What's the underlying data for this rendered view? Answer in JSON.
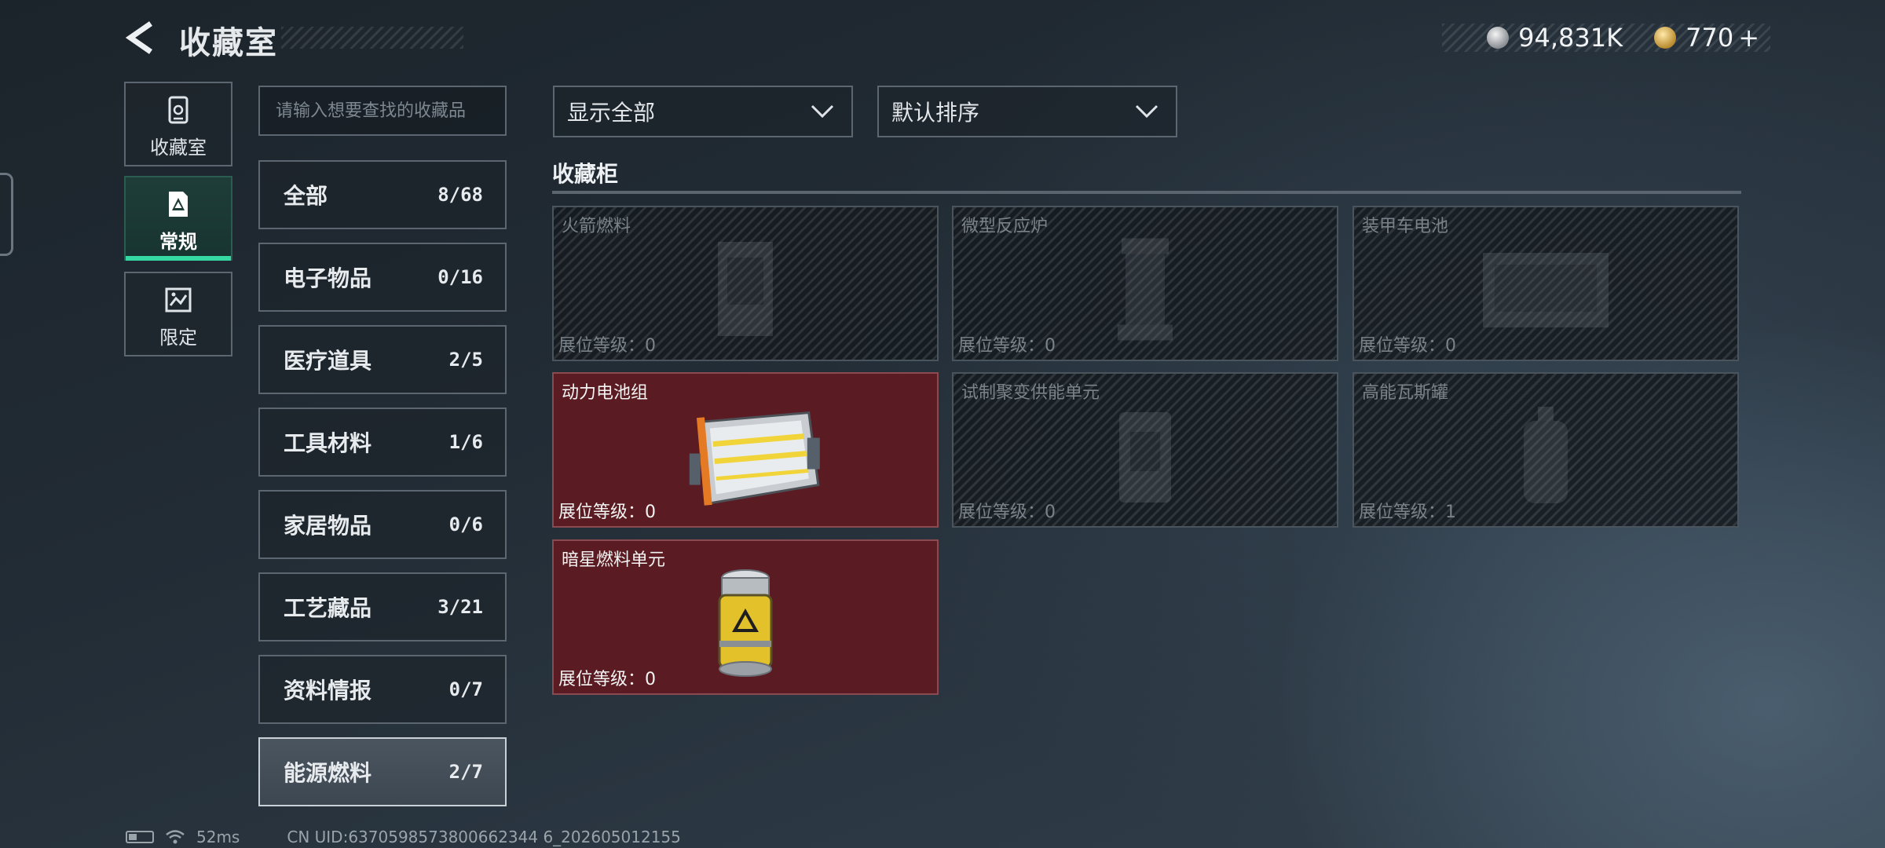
{
  "header": {
    "title": "收藏室",
    "currency_silver": "94,831K",
    "currency_gold": "770",
    "add_symbol": "+"
  },
  "side_tabs": [
    {
      "label": "收藏室",
      "icon": "collection-room-icon"
    },
    {
      "label": "常规",
      "icon": "regular-icon",
      "active": true
    },
    {
      "label": "限定",
      "icon": "limited-icon"
    }
  ],
  "search": {
    "placeholder": "请输入想要查找的收藏品"
  },
  "categories": [
    {
      "name": "全部",
      "count": "8/68"
    },
    {
      "name": "电子物品",
      "count": "0/16"
    },
    {
      "name": "医疗道具",
      "count": "2/5"
    },
    {
      "name": "工具材料",
      "count": "1/6"
    },
    {
      "name": "家居物品",
      "count": "0/6"
    },
    {
      "name": "工艺藏品",
      "count": "3/21"
    },
    {
      "name": "资料情报",
      "count": "0/7"
    },
    {
      "name": "能源燃料",
      "count": "2/7",
      "active": true
    }
  ],
  "filters": {
    "display": "显示全部",
    "sort": "默认排序"
  },
  "section": {
    "title": "收藏柜"
  },
  "items": [
    {
      "name": "火箭燃料",
      "level": "展位等级：0",
      "owned": false
    },
    {
      "name": "微型反应炉",
      "level": "展位等级：0",
      "owned": false
    },
    {
      "name": "装甲车电池",
      "level": "展位等级：0",
      "owned": false
    },
    {
      "name": "动力电池组",
      "level": "展位等级：0",
      "owned": true
    },
    {
      "name": "试制聚变供能单元",
      "level": "展位等级：0",
      "owned": false
    },
    {
      "name": "高能瓦斯罐",
      "level": "展位等级：1",
      "owned": false
    },
    {
      "name": "暗星燃料单元",
      "level": "展位等级：0",
      "owned": true
    }
  ],
  "status": {
    "ping": "52ms",
    "uid": "CN UID:6370598573800662344 6_202605012155"
  },
  "colors": {
    "accent": "#35d8a0",
    "owned_card": "#5a1c22"
  }
}
